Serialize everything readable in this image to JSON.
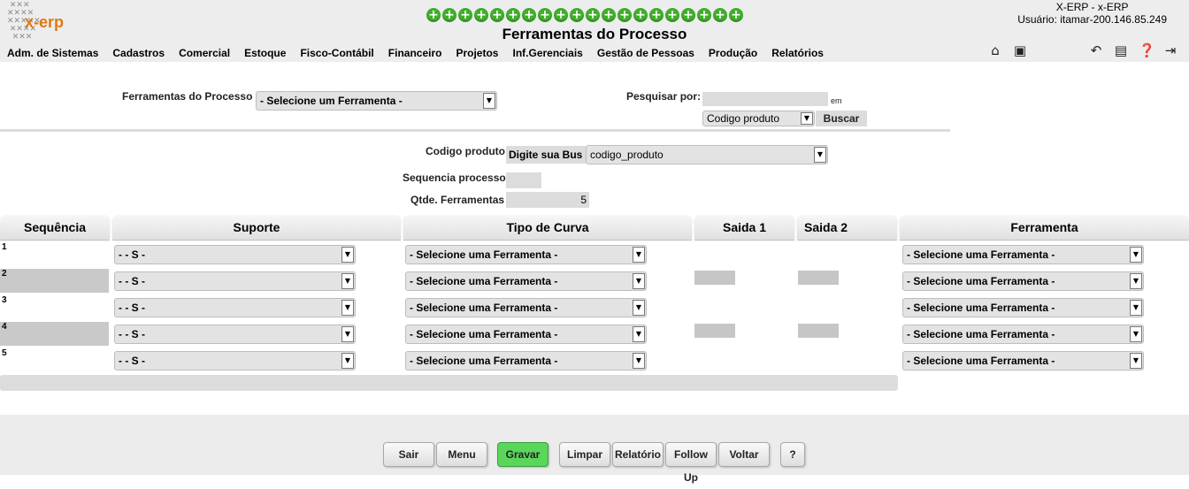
{
  "header": {
    "logo_text": "x-erp",
    "title": "Ferramentas do Processo",
    "system_line": "X-ERP - x-ERP",
    "user_line": "Usuário: itamar-200.146.85.249",
    "plus_count": 20
  },
  "menu": [
    "Adm. de Sistemas",
    "Cadastros",
    "Comercial",
    "Estoque",
    "Fisco-Contábil",
    "Financeiro",
    "Projetos",
    "Inf.Gerenciais",
    "Gestão de Pessoas",
    "Produção",
    "Relatórios"
  ],
  "form": {
    "ferramentas_label": "Ferramentas do Processo",
    "ferramentas_value": "- Selecione um Ferramenta -",
    "pesquisar_label": "Pesquisar por:",
    "pesquisar_value": "",
    "em_label": "em",
    "search_field_value": "Codigo produto",
    "buscar_label": "Buscar",
    "codigo_label": "Codigo produto",
    "codigo_search_value": "Digite sua Bus",
    "codigo_select_value": "codigo_produto",
    "sequencia_label": "Sequencia processo",
    "sequencia_value": "",
    "qtde_label": "Qtde. Ferramentas",
    "qtde_value": "5"
  },
  "table": {
    "headers": {
      "sequencia": "Sequência",
      "suporte": "Suporte",
      "tipo_curva": "Tipo de Curva",
      "saida1": "Saida 1",
      "saida2": "Saida 2",
      "ferramenta": "Ferramenta"
    },
    "rows": [
      {
        "num": "1",
        "suporte": "- - S -",
        "curva": "- Selecione uma Ferramenta -",
        "ferramenta": "- Selecione uma Ferramenta -"
      },
      {
        "num": "2",
        "suporte": "- - S -",
        "curva": "- Selecione uma Ferramenta -",
        "ferramenta": "- Selecione uma Ferramenta -"
      },
      {
        "num": "3",
        "suporte": "- - S -",
        "curva": "- Selecione uma Ferramenta -",
        "ferramenta": "- Selecione uma Ferramenta -"
      },
      {
        "num": "4",
        "suporte": "- - S -",
        "curva": "- Selecione uma Ferramenta -",
        "ferramenta": "- Selecione uma Ferramenta -"
      },
      {
        "num": "5",
        "suporte": "- - S -",
        "curva": "- Selecione uma Ferramenta -",
        "ferramenta": "- Selecione uma Ferramenta -"
      }
    ]
  },
  "buttons": {
    "sair": "Sair",
    "menu": "Menu",
    "gravar": "Gravar",
    "limpar": "Limpar",
    "relatorio": "Relatório",
    "followup": "Follow Up",
    "voltar": "Voltar",
    "help": "?"
  },
  "icons": {
    "home": "home-icon",
    "save": "save-icon",
    "back": "back-arrow-icon",
    "notes": "notes-icon",
    "help": "help-icon",
    "exit": "exit-icon"
  },
  "colors": {
    "accent_green": "#3fae2a",
    "save_green": "#5ad65a",
    "logo_orange": "#e07a10"
  }
}
